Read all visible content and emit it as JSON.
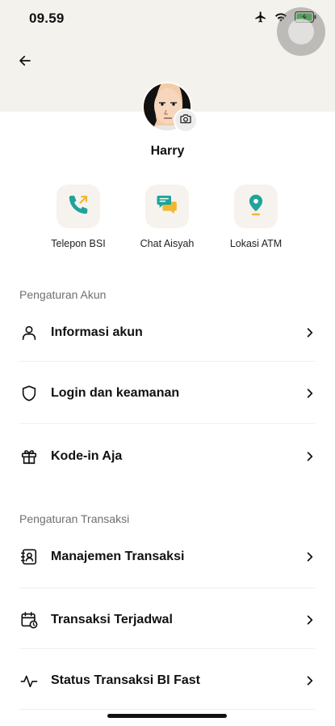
{
  "status_bar": {
    "time": "09.59",
    "icons": [
      "airplane-icon",
      "wifi-icon",
      "battery-charging-icon"
    ]
  },
  "header": {
    "back_icon": "arrow-left-icon"
  },
  "profile": {
    "name": "Harry",
    "camera_icon": "camera-icon"
  },
  "quick_actions": [
    {
      "label": "Telepon BSI",
      "icon": "phone-icon"
    },
    {
      "label": "Chat Aisyah",
      "icon": "chat-icon"
    },
    {
      "label": "Lokasi ATM",
      "icon": "location-pin-icon"
    }
  ],
  "sections": [
    {
      "title": "Pengaturan Akun",
      "items": [
        {
          "label": "Informasi akun",
          "icon": "user-icon"
        },
        {
          "label": "Login dan keamanan",
          "icon": "shield-icon"
        },
        {
          "label": "Kode-in Aja",
          "icon": "gift-icon"
        }
      ]
    },
    {
      "title": "Pengaturan Transaksi",
      "items": [
        {
          "label": "Manajemen Transaksi",
          "icon": "contact-book-icon"
        },
        {
          "label": "Transaksi Terjadwal",
          "icon": "calendar-clock-icon"
        },
        {
          "label": "Status Transaksi BI Fast",
          "icon": "activity-icon"
        }
      ]
    }
  ],
  "colors": {
    "header_bg": "#f4f2ec",
    "accent_teal": "#1fa39a",
    "accent_yellow": "#f2b630",
    "text": "#111111",
    "muted": "#6f6f6f"
  }
}
